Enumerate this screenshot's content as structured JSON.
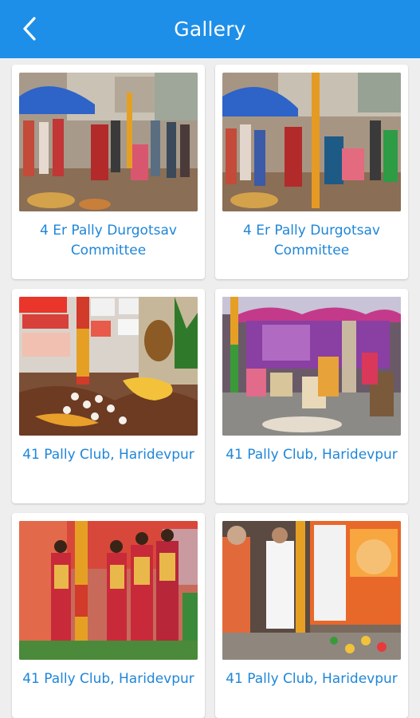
{
  "header": {
    "title": "Gallery",
    "back_icon": "chevron-left-icon"
  },
  "colors": {
    "appbar": "#1e8fe8",
    "caption": "#1f86d8",
    "background": "#eeeeee"
  },
  "gallery": {
    "items": [
      {
        "caption": "4 Er Pally Durgotsav\nCommittee"
      },
      {
        "caption": "4 Er Pally Durgotsav\nCommittee"
      },
      {
        "caption": "41 Pally Club, Haridevpur"
      },
      {
        "caption": "41 Pally Club, Haridevpur"
      },
      {
        "caption": "41 Pally Club, Haridevpur"
      },
      {
        "caption": "41 Pally Club, Haridevpur"
      }
    ]
  }
}
